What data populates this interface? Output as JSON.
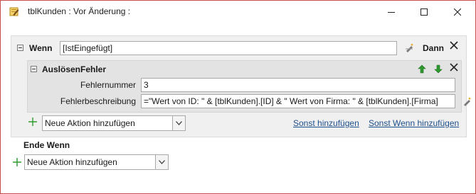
{
  "window": {
    "title": "tblKunden : Vor Änderung :",
    "icons": {
      "app": "macro-edit-icon",
      "minimize": "minimize-icon",
      "maximize": "maximize-icon",
      "close": "close-icon"
    }
  },
  "if_block": {
    "keyword": "Wenn",
    "condition": "[IstEingefügt]",
    "then_label": "Dann",
    "action": {
      "name": "AuslösenFehler",
      "fields": [
        {
          "label": "Fehlernummer",
          "value": "3"
        },
        {
          "label": "Fehlerbeschreibung",
          "value": "=\"Wert von ID: \" & [tblKunden].[ID] & \" Wert von Firma: \" & [tblKunden].[Firma]"
        }
      ]
    },
    "add_action": {
      "placeholder": "Neue Aktion hinzufügen"
    },
    "links": {
      "else": "Sonst hinzufügen",
      "else_if": "Sonst Wenn hinzufügen"
    }
  },
  "end_if": "Ende Wenn",
  "bottom_add_action": {
    "placeholder": "Neue Aktion hinzufügen"
  },
  "colors": {
    "accent_border": "#c8504a",
    "link": "#1d4f8c",
    "arrow_green": "#2e9a2e"
  }
}
